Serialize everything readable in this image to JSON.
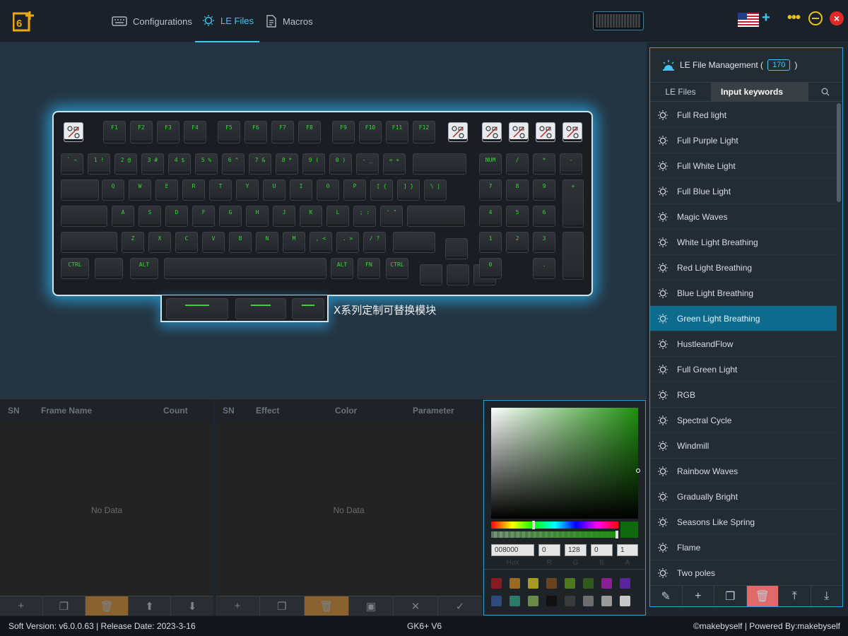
{
  "nav": {
    "tabs": [
      {
        "label": "Configurations",
        "icon": "keyboard-icon"
      },
      {
        "label": "LE Files",
        "icon": "bulb-icon",
        "active": true
      },
      {
        "label": "Macros",
        "icon": "document-icon"
      }
    ]
  },
  "colors": {
    "accent": "#3fc7f5",
    "key_green": "#35d635",
    "selected_row": "#0d6b8e",
    "close": "#e02a2a",
    "window_ctrl": "#e8c01a"
  },
  "keyboard": {
    "fn_row": [
      "F1",
      "F2",
      "F3",
      "F4",
      "F5",
      "F6",
      "F7",
      "F8",
      "F9",
      "F10",
      "F11",
      "F12"
    ],
    "num_row": [
      "` ~",
      "1 !",
      "2 @",
      "3 #",
      "4 $",
      "5 %",
      "6 ^",
      "7 &",
      "8 *",
      "9 (",
      "0 )",
      "- _",
      "= +"
    ],
    "top_row": [
      "Q",
      "W",
      "E",
      "R",
      "T",
      "Y",
      "U",
      "I",
      "O",
      "P",
      "[ {",
      "] }",
      "\\ |"
    ],
    "home_row": [
      "A",
      "S",
      "D",
      "F",
      "G",
      "H",
      "J",
      "K",
      "L",
      "; :",
      "' \""
    ],
    "bottom_row": [
      "Z",
      "X",
      "C",
      "V",
      "B",
      "N",
      "M",
      ", <",
      ". >",
      "/ ?"
    ],
    "mod_left": [
      "CTRL",
      "ALT"
    ],
    "mod_right": [
      "ALT",
      "FN",
      "CTRL"
    ],
    "numpad_top": [
      "NUM",
      "/",
      "*",
      "-"
    ],
    "numpad_r1": [
      "7",
      "8",
      "9"
    ],
    "numpad_r2": [
      "4",
      "5",
      "6"
    ],
    "numpad_r3": [
      "1",
      "2",
      "3"
    ],
    "numpad_plus": "+",
    "numpad_zero": "0",
    "numpad_dot": "."
  },
  "module_caption": "X系列定制可替换模块",
  "le_panel": {
    "title": "LE File Management (",
    "title_close": ")",
    "count": "170",
    "tab_files": "LE Files",
    "search_placeholder": "Input keywords",
    "items": [
      "Full Red light",
      "Full Purple Light",
      "Full White Light",
      "Full Blue Light",
      "Magic Waves",
      "White Light Breathing",
      "Red Light Breathing",
      "Blue Light Breathing",
      "Green Light Breathing",
      "HustleandFlow",
      "Full Green Light",
      "RGB",
      "Spectral Cycle",
      "Windmill",
      "Rainbow Waves",
      "Gradually Bright",
      "Seasons Like Spring",
      "Flame",
      "Two poles"
    ],
    "selected_index": 8,
    "toolbar": [
      "edit-icon",
      "add-icon",
      "copy-icon",
      "delete-icon",
      "upload-icon",
      "download-icon"
    ]
  },
  "frames_table": {
    "headers": [
      "SN",
      "Frame Name",
      "Count"
    ],
    "empty_text": "No Data"
  },
  "effects_table": {
    "headers": [
      "SN",
      "Effect",
      "Color",
      "Parameter"
    ],
    "empty_text": "No Data"
  },
  "color_picker": {
    "hex": "008000",
    "r": "0",
    "g": "128",
    "b": "0",
    "a": "1",
    "labels": [
      "Hex",
      "R",
      "G",
      "B",
      "A"
    ],
    "swatches": [
      "#8a1a22",
      "#9a6a1e",
      "#a89a20",
      "#6a4220",
      "#4e7a1e",
      "#2f5a1c",
      "#8a1e96",
      "#5a24a0",
      "#2c4a7e",
      "#2a7a6a",
      "#6a8a4a",
      "#111111",
      "#3a3a3a",
      "#6e6e6e",
      "#9a9a9a",
      "#c8c8c8"
    ]
  },
  "status": {
    "version": "Soft Version: v6.0.0.63 | Release Date: 2023-3-16",
    "device": "GK6+ V6",
    "credit": "©makebyself | Powered By:makebyself"
  }
}
